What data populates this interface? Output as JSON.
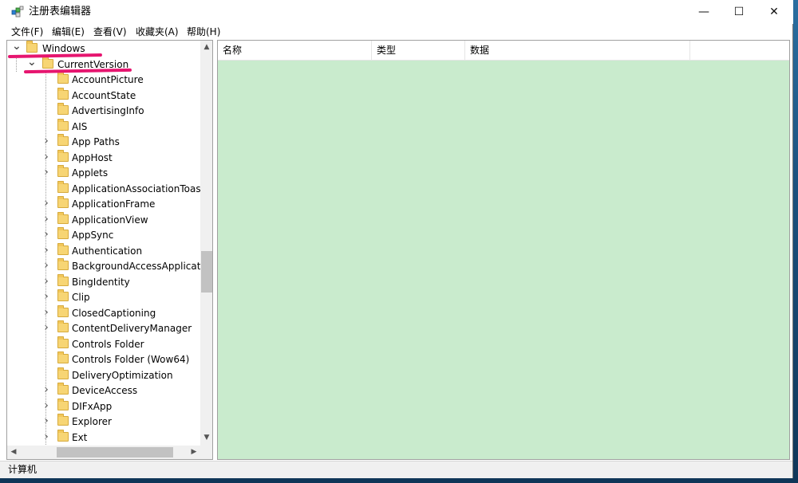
{
  "window": {
    "title": "注册表编辑器",
    "controls": {
      "minimize": "—",
      "maximize": "☐",
      "close": "✕"
    }
  },
  "menu": [
    {
      "label": "文件(F)"
    },
    {
      "label": "编辑(E)"
    },
    {
      "label": "查看(V)"
    },
    {
      "label": "收藏夹(A)"
    },
    {
      "label": "帮助(H)"
    }
  ],
  "tree": {
    "items": [
      {
        "label": "Windows",
        "level": 0,
        "expanded": true,
        "has_children": true
      },
      {
        "label": "CurrentVersion",
        "level": 1,
        "expanded": true,
        "has_children": true
      },
      {
        "label": "AccountPicture",
        "level": 2,
        "has_children": false
      },
      {
        "label": "AccountState",
        "level": 2,
        "has_children": false
      },
      {
        "label": "AdvertisingInfo",
        "level": 2,
        "has_children": false
      },
      {
        "label": "AIS",
        "level": 2,
        "has_children": false
      },
      {
        "label": "App Paths",
        "level": 2,
        "has_children": true
      },
      {
        "label": "AppHost",
        "level": 2,
        "has_children": true
      },
      {
        "label": "Applets",
        "level": 2,
        "has_children": true
      },
      {
        "label": "ApplicationAssociationToast",
        "level": 2,
        "has_children": false
      },
      {
        "label": "ApplicationFrame",
        "level": 2,
        "has_children": true
      },
      {
        "label": "ApplicationView",
        "level": 2,
        "has_children": true
      },
      {
        "label": "AppSync",
        "level": 2,
        "has_children": true
      },
      {
        "label": "Authentication",
        "level": 2,
        "has_children": true
      },
      {
        "label": "BackgroundAccessApplicati",
        "level": 2,
        "has_children": true
      },
      {
        "label": "BingIdentity",
        "level": 2,
        "has_children": true
      },
      {
        "label": "Clip",
        "level": 2,
        "has_children": true
      },
      {
        "label": "ClosedCaptioning",
        "level": 2,
        "has_children": true
      },
      {
        "label": "ContentDeliveryManager",
        "level": 2,
        "has_children": true
      },
      {
        "label": "Controls Folder",
        "level": 2,
        "has_children": false
      },
      {
        "label": "Controls Folder (Wow64)",
        "level": 2,
        "has_children": false
      },
      {
        "label": "DeliveryOptimization",
        "level": 2,
        "has_children": false
      },
      {
        "label": "DeviceAccess",
        "level": 2,
        "has_children": true
      },
      {
        "label": "DIFxApp",
        "level": 2,
        "has_children": true
      },
      {
        "label": "Explorer",
        "level": 2,
        "has_children": true
      },
      {
        "label": "Ext",
        "level": 2,
        "has_children": true
      }
    ]
  },
  "list": {
    "columns": [
      {
        "label": "名称"
      },
      {
        "label": "类型"
      },
      {
        "label": "数据"
      }
    ]
  },
  "status": {
    "path": "计算机"
  },
  "colors": {
    "list_background": "#c9ebcd",
    "annotation": "#e6156f",
    "folder": "#f7d574"
  },
  "icons": {
    "app": "registry-editor-icon",
    "folder": "folder-icon",
    "expand": "chevron-right-icon",
    "collapse": "chevron-down-icon"
  }
}
